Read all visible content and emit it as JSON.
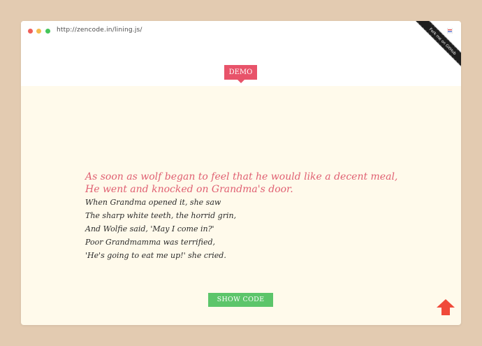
{
  "browser": {
    "url": "http://zencode.in/lining.js/"
  },
  "ribbon": {
    "label": "Fork me on GitHub"
  },
  "demo_badge": {
    "label": "DEMO"
  },
  "poem": {
    "highlighted_lines": [
      "As soon as wolf began to feel that he would like a decent meal,",
      "He went and knocked on Grandma's door."
    ],
    "lines": [
      "When Grandma opened it, she saw",
      "The sharp white teeth, the horrid grin,",
      "And Wolfie said, 'May I come in?'",
      "Poor Grandmamma was terrified,",
      "'He's going to eat me up!' she cried."
    ]
  },
  "show_code_button": {
    "label": "SHOW CODE"
  },
  "colors": {
    "page_background": "#e3cbb1",
    "content_background": "#fffaeb",
    "accent_pink": "#e8536a",
    "button_green": "#5cc56a",
    "arrow_red": "#f04a3a"
  }
}
